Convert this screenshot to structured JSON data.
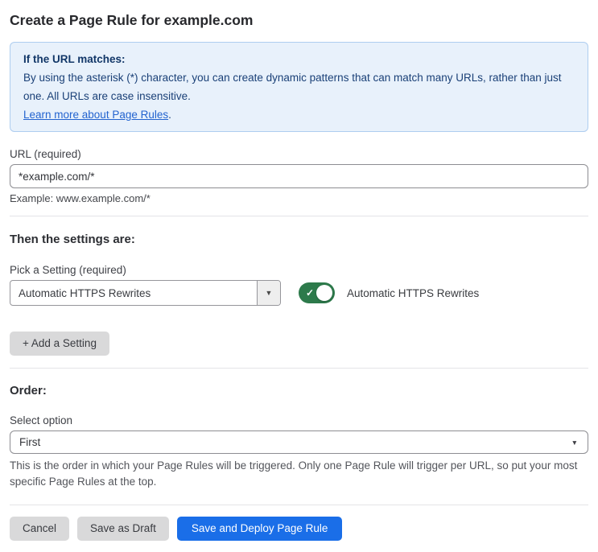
{
  "page": {
    "title": "Create a Page Rule for example.com"
  },
  "info_box": {
    "heading": "If the URL matches:",
    "body": "By using the asterisk (*) character, you can create dynamic patterns that can match many URLs, rather than just one. All URLs are case insensitive.",
    "link_label": "Learn more about Page Rules",
    "link_suffix": "."
  },
  "url_field": {
    "label": "URL (required)",
    "value": "*example.com/*",
    "helper": "Example: www.example.com/*"
  },
  "settings_section": {
    "heading": "Then the settings are:",
    "picker_label": "Pick a Setting (required)",
    "picker_value": "Automatic HTTPS Rewrites",
    "picker_arrow_icon": "▼",
    "toggle_state": "on",
    "toggle_check_icon": "✓",
    "toggle_label": "Automatic HTTPS Rewrites",
    "add_setting_label": "+ Add a Setting"
  },
  "order_section": {
    "heading": "Order:",
    "select_label": "Select option",
    "select_value": "First",
    "select_arrow_icon": "▼",
    "helper": "This is the order in which your Page Rules will be triggered. Only one Page Rule will trigger per URL, so put your most specific Page Rules at the top."
  },
  "footer": {
    "cancel_label": "Cancel",
    "save_draft_label": "Save as Draft",
    "save_deploy_label": "Save and Deploy Page Rule"
  },
  "colors": {
    "info_box_bg": "#e8f1fb",
    "info_box_border": "#aecdf0",
    "info_text": "#15396b",
    "link_blue": "#2263cf",
    "toggle_green": "#2d7a4b",
    "primary_button_blue": "#1a6ee8",
    "gray_button_bg": "#d9d9da"
  }
}
